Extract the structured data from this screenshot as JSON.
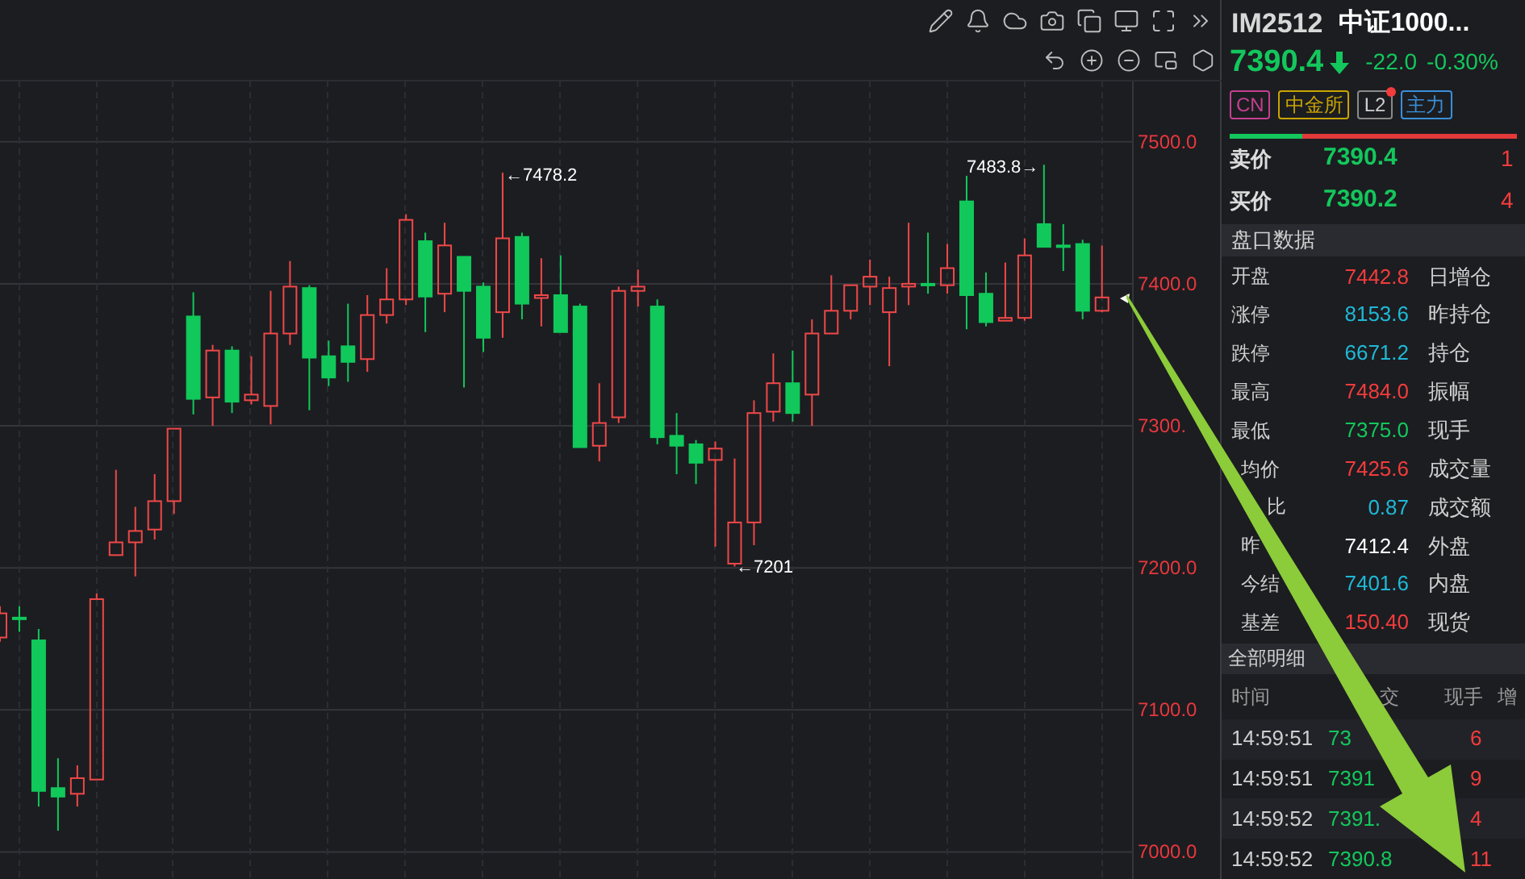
{
  "chart": {
    "chart_data": {
      "type": "candlestick",
      "grid": true,
      "ylim": [
        6981,
        7543
      ],
      "ohlc": [
        [
          7151,
          7173,
          7148,
          7168
        ],
        [
          7165,
          7173,
          7155,
          7164
        ],
        [
          7149,
          7157,
          7032,
          7043
        ],
        [
          7045,
          7066,
          7015,
          7039
        ],
        [
          7041,
          7061,
          7032,
          7052
        ],
        [
          7051,
          7182,
          7051,
          7178
        ],
        [
          7209,
          7269,
          7209,
          7218
        ],
        [
          7218,
          7243,
          7194,
          7226
        ],
        [
          7227,
          7266,
          7220,
          7247
        ],
        [
          7247,
          7298,
          7238,
          7298
        ],
        [
          7377,
          7394,
          7308,
          7319
        ],
        [
          7320,
          7357,
          7300,
          7353
        ],
        [
          7353,
          7356,
          7309,
          7317
        ],
        [
          7318,
          7349,
          7315,
          7322
        ],
        [
          7314,
          7395,
          7301,
          7365
        ],
        [
          7365,
          7416,
          7357,
          7398
        ],
        [
          7397,
          7399,
          7311,
          7348
        ],
        [
          7349,
          7360,
          7328,
          7334
        ],
        [
          7356,
          7386,
          7331,
          7345
        ],
        [
          7347,
          7392,
          7338,
          7378
        ],
        [
          7378,
          7411,
          7372,
          7389
        ],
        [
          7389,
          7449,
          7385,
          7445
        ],
        [
          7430,
          7436,
          7366,
          7391
        ],
        [
          7393,
          7443,
          7380,
          7427
        ],
        [
          7419,
          7419,
          7327,
          7395
        ],
        [
          7398,
          7401,
          7352,
          7362
        ],
        [
          7380,
          7478.2,
          7362,
          7432
        ],
        [
          7433,
          7436,
          7375,
          7386
        ],
        [
          7390,
          7418,
          7370,
          7392
        ],
        [
          7392,
          7420,
          7366,
          7366
        ],
        [
          7384,
          7386,
          7285,
          7285
        ],
        [
          7286,
          7330,
          7275,
          7302
        ],
        [
          7306,
          7398,
          7302,
          7395
        ],
        [
          7395,
          7410,
          7384,
          7398
        ],
        [
          7384,
          7389,
          7287,
          7292
        ],
        [
          7293,
          7309,
          7266,
          7286
        ],
        [
          7287,
          7290,
          7259,
          7274
        ],
        [
          7276,
          7289,
          7215,
          7284
        ],
        [
          7203,
          7277,
          7201,
          7232
        ],
        [
          7232,
          7318,
          7216,
          7309
        ],
        [
          7310,
          7351,
          7303,
          7330
        ],
        [
          7330,
          7353,
          7303,
          7309
        ],
        [
          7322,
          7375,
          7300,
          7365
        ],
        [
          7365,
          7406,
          7365,
          7381
        ],
        [
          7381,
          7399,
          7375,
          7399
        ],
        [
          7398,
          7417,
          7385,
          7405
        ],
        [
          7380,
          7405,
          7342,
          7397
        ],
        [
          7398,
          7443,
          7385,
          7400
        ],
        [
          7400,
          7436,
          7393,
          7399
        ],
        [
          7399,
          7428,
          7393,
          7411
        ],
        [
          7458,
          7476,
          7368,
          7392
        ],
        [
          7393,
          7408,
          7370,
          7373
        ],
        [
          7374,
          7415,
          7374,
          7376
        ],
        [
          7376,
          7432,
          7374,
          7420
        ],
        [
          7442,
          7483.8,
          7426,
          7426
        ],
        [
          7427,
          7442,
          7409,
          7426
        ],
        [
          7428,
          7431,
          7375,
          7381
        ],
        [
          7381,
          7427,
          7380,
          7390.4
        ]
      ],
      "yticks": [
        {
          "value": 7500,
          "label": "7500.0"
        },
        {
          "value": 7400,
          "label": "7400.0"
        },
        {
          "value": 7300,
          "label": "7300."
        },
        {
          "value": 7200,
          "label": "7200.0"
        },
        {
          "value": 7100,
          "label": "7100.0"
        },
        {
          "value": 7000,
          "label": "7000.0"
        }
      ],
      "annotations": [
        {
          "text": "←7478.2"
        },
        {
          "text": "7483.8→"
        },
        {
          "text": "←7201"
        }
      ]
    }
  },
  "quote": {
    "code": "IM2512",
    "name": "中证1000...",
    "price": "7390.4",
    "down": true,
    "change": "-22.0",
    "change_pct": "-0.30%"
  },
  "tags": [
    {
      "label": "CN",
      "color": "#c2408f",
      "dot": false
    },
    {
      "label": "中金所",
      "color": "#c9a400",
      "dot": false
    },
    {
      "label": "L2",
      "color": "#8a8a8a",
      "dot": true
    },
    {
      "label": "主力",
      "color": "#3a8fd9",
      "dot": false
    }
  ],
  "balance": {
    "level": 0.25
  },
  "bid_ask": [
    {
      "label": "卖价",
      "price": "7390.4",
      "volume": "1"
    },
    {
      "label": "买价",
      "price": "7390.2",
      "volume": "4"
    }
  ],
  "order_book": {
    "title": "盘口数据",
    "rows": [
      {
        "label": "开盘",
        "value": "7442.8",
        "color": "#f23c3c",
        "label_2": "日增仓"
      },
      {
        "label": "涨停",
        "value": "8153.6",
        "color": "#1fb8d6",
        "label_2": "昨持仓"
      },
      {
        "label": "跌停",
        "value": "6671.2",
        "color": "#1fb8d6",
        "label_2": "持仓"
      },
      {
        "label": "最高",
        "value": "7484.0",
        "color": "#f23c3c",
        "label_2": "振幅"
      },
      {
        "label": "最低",
        "value": "7375.0",
        "color": "#13c75c",
        "label_2": "现手"
      },
      {
        "label": "均价",
        "value": "7425.6",
        "color": "#f23c3c",
        "label_2": "成交量"
      },
      {
        "label": "比",
        "value": "0.87",
        "color": "#1fb8d6",
        "label_2": "成交额"
      },
      {
        "label": "昨",
        "value": "7412.4",
        "color": "#ffffff",
        "label_2": "外盘"
      },
      {
        "label": "今结",
        "value": "7401.6",
        "color": "#1fb8d6",
        "label_2": "内盘"
      },
      {
        "label": "基差",
        "value": "150.40",
        "color": "#f23c3c",
        "label_2": "现货"
      }
    ]
  },
  "trades": {
    "title": "全部明细",
    "columns": [
      "时间",
      "交",
      "现手",
      "增"
    ],
    "rows": [
      {
        "time": "14:59:51",
        "price": "73",
        "volume": "6"
      },
      {
        "time": "14:59:51",
        "price": "7391",
        "volume": "9"
      },
      {
        "time": "14:59:52",
        "price": "7391.",
        "volume": "4"
      },
      {
        "time": "14:59:52",
        "price": "7390.8",
        "volume": "11"
      }
    ]
  }
}
